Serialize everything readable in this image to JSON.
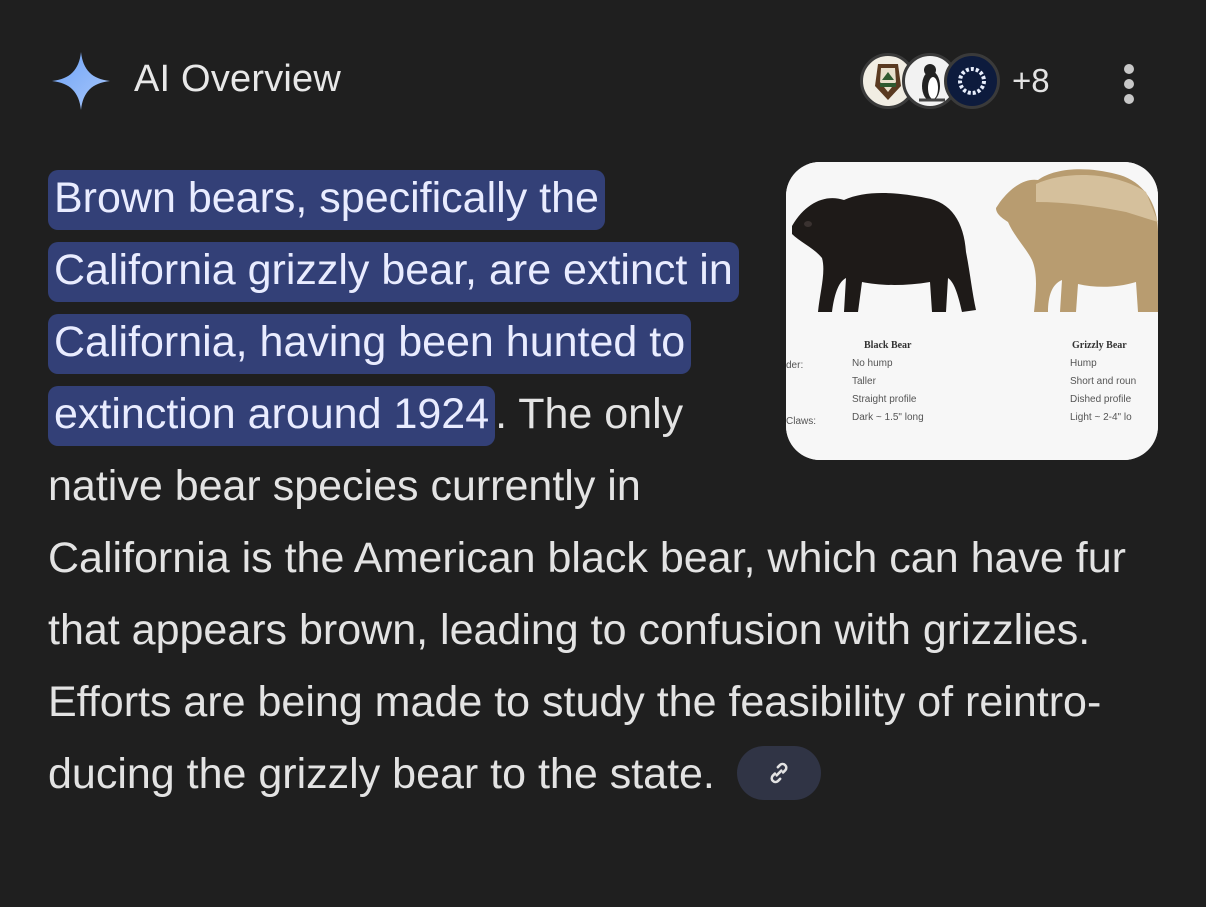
{
  "header": {
    "title": "AI Overview",
    "more_sources": "+8",
    "sparkle_icon": "sparkle-icon",
    "menu_icon": "more-vert-icon"
  },
  "sources": [
    {
      "icon": "nps-arrowhead-icon"
    },
    {
      "icon": "penguin-icon"
    },
    {
      "icon": "circle-logo-icon"
    }
  ],
  "overview": {
    "highlighted": "Brown bears, specifically the California grizzly bear, are ex­tinct in California, having been hunted to extinction around 1924",
    "rest": ". The only native bear species currently in California is the American black bear, which can have fur that appears brown, leading to confusion with grizzlies. Efforts are being made to study the feasibility of reintro­ducing the grizzly bear to the state."
  },
  "image": {
    "black_title": "Black Bear",
    "black_lines": [
      "No hump",
      "Taller",
      "Straight profile",
      "Dark ~ 1.5\" long"
    ],
    "grizzly_title": "Grizzly Bear",
    "grizzly_lines": [
      "Hump",
      "Short and roun",
      "Dished profile",
      "Light ~ 2-4\" lo"
    ],
    "row_label_1": "der:",
    "row_label_2": "Claws:"
  },
  "colors": {
    "background": "#1f1f1f",
    "highlight": "#334077",
    "sparkle": "#8ab4f8",
    "link_chip": "#303445"
  },
  "link_icon": "link-icon"
}
